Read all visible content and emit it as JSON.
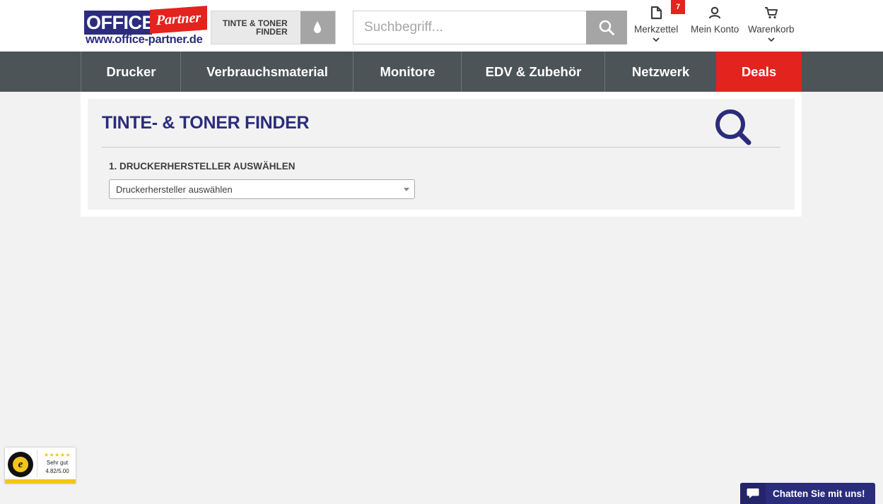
{
  "header": {
    "logo": {
      "office": "OFFICE",
      "partner": "Partner",
      "url": "www.office-partner.de"
    },
    "finder_button": {
      "line1": "TINTE & TONER",
      "line2": "FINDER",
      "icon": "ink-drop-icon"
    },
    "search": {
      "placeholder": "Suchbegriff...",
      "value": "",
      "icon": "search-icon"
    },
    "links": [
      {
        "label": "Merkzettel",
        "icon": "document-icon",
        "badge": "7"
      },
      {
        "label": "Mein Konto",
        "icon": "user-icon"
      },
      {
        "label": "Warenkorb",
        "icon": "cart-icon"
      }
    ]
  },
  "nav": {
    "items": [
      "Drucker",
      "Verbrauchsmaterial",
      "Monitore",
      "EDV & Zubehör",
      "Netzwerk",
      "Deals"
    ]
  },
  "finder": {
    "title": "TINTE- & TONER FINDER",
    "step1_label": "1. DRUCKERHERSTELLER AUSWÄHLEN",
    "step1_select": "Druckerhersteller auswählen"
  },
  "trust_badge": {
    "stars": "★★★★★",
    "rating_text": "Sehr gut",
    "score": "4.82/5.00"
  },
  "chat": {
    "label": "Chatten Sie mit uns!"
  },
  "colors": {
    "brand_blue": "#2b2c7c",
    "brand_red": "#e3231e",
    "nav_bg": "#4c5458",
    "page_bg": "#f2f2f2"
  }
}
